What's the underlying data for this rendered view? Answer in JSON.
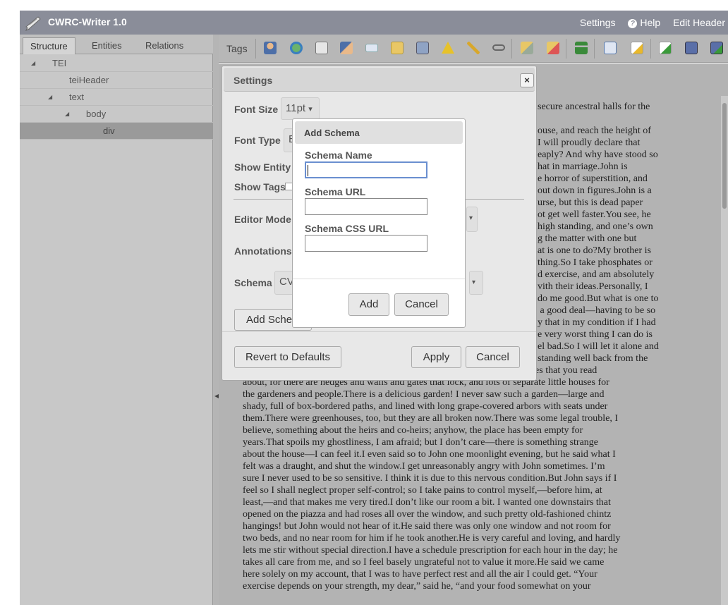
{
  "header": {
    "app_title": "CWRC-Writer 1.0",
    "nav": {
      "settings": "Settings",
      "help": "Help",
      "edit_header": "Edit Header"
    }
  },
  "left_tabs": [
    "Structure",
    "Entities",
    "Relations"
  ],
  "tree": [
    {
      "label": "TEI",
      "expanded": true
    },
    {
      "label": "teiHeader",
      "expanded": false
    },
    {
      "label": "text",
      "expanded": true
    },
    {
      "label": "body",
      "expanded": true
    },
    {
      "label": "div",
      "selected": true
    }
  ],
  "toolbar": {
    "tags_label": "Tags",
    "icons": [
      "person-icon",
      "place-icon",
      "date-icon",
      "org-icon",
      "citation-icon",
      "note-icon",
      "title-icon",
      "warning-icon",
      "key-icon",
      "link-icon",
      "tag-edit-icon",
      "tag-remove-icon",
      "tree-icon",
      "import-icon",
      "edit-icon",
      "validate-icon",
      "save-icon",
      "save-as-icon"
    ]
  },
  "document_lines": [
    "secure ancestral halls for the",
    "",
    "ouse, and reach the height of",
    "I will proudly declare that",
    "eaply? And why have stood so",
    "hat in marriage.John is",
    "e horror of superstition, and",
    "out down in figures.John is a",
    "urse, but this is dead paper",
    "ot get well faster.You see, he",
    "high standing, and one’s own",
    "g the matter with one but",
    "at is one to do?My brother is",
    "thing.So I take phosphates or",
    "d exercise, and am absolutely",
    "vith their ideas.Personally, I",
    "do me good.But what is one to",
    " a good deal—having to be so",
    "y that in my condition if I had",
    "e very worst thing I can do is",
    "el bad.So I will let it alone and",
    "standing well back from the",
    "road, quite three miles from the village. It makes me think of English places that you read",
    "about, for there are hedges and walls and gates that lock, and lots of separate little houses for",
    "the gardeners and people.There is a delicious garden! I never saw such a garden—large and",
    "shady, full of box-bordered paths, and lined with long grape-covered arbors with seats under",
    "them.There were greenhouses, too, but they are all broken now.There was some legal trouble, I",
    "believe, something about the heirs and co-heirs; anyhow, the place has been empty for",
    "years.That spoils my ghostliness, I am afraid; but I don’t care—there is something strange",
    "about the house—I can feel it.I even said so to John one moonlight evening, but he said what I",
    "felt was a draught, and shut the window.I get unreasonably angry with John sometimes. I’m",
    "sure I never used to be so sensitive. I think it is due to this nervous condition.But John says if I",
    "feel so I shall neglect proper self-control; so I take pains to control myself,—before him, at",
    "least,—and that makes me very tired.I don’t like our room a bit. I wanted one downstairs that",
    "opened on the piazza and had roses all over the window, and such pretty old-fashioned chintz",
    "hangings! but John would not hear of it.He said there was only one window and not room for",
    "two beds, and no near room for him if he took another.He is very careful and loving, and hardly",
    "lets me stir without special direction.I have a schedule prescription for each hour in the day; he",
    "takes all care from me, and so I feel basely ungrateful not to value it more.He said we came",
    "here solely on my account, that I was to have perfect rest and all the air I could get. “Your",
    "exercise depends on your strength, my dear,” said he, “and your food somewhat on your"
  ],
  "settings_dialog": {
    "title": "Settings",
    "close": "×",
    "font_size_label": "Font Size",
    "font_size_value": "11pt",
    "font_size_caret": "▾",
    "font_type_label": "Font Type",
    "font_type_value": "E",
    "show_entity_label": "Show Entity",
    "show_tags_label": "Show Tags",
    "editor_mode_label": "Editor Mode",
    "annotations_label": "Annotations",
    "schema_label": "Schema",
    "schema_value": "CV",
    "add_schema_button": "Add Schem",
    "revert_button": "Revert to Defaults",
    "apply_button": "Apply",
    "cancel_button": "Cancel"
  },
  "add_schema_dialog": {
    "title": "Add Schema",
    "schema_name_label": "Schema Name",
    "schema_name_value": "",
    "schema_url_label": "Schema URL",
    "schema_url_value": "",
    "schema_css_url_label": "Schema CSS URL",
    "schema_css_url_value": "",
    "add_button": "Add",
    "cancel_button": "Cancel"
  },
  "colors": {
    "header_bg": "#8a8d99",
    "overlay": "#b3b3b3",
    "focus_border": "#6a8fd0"
  }
}
